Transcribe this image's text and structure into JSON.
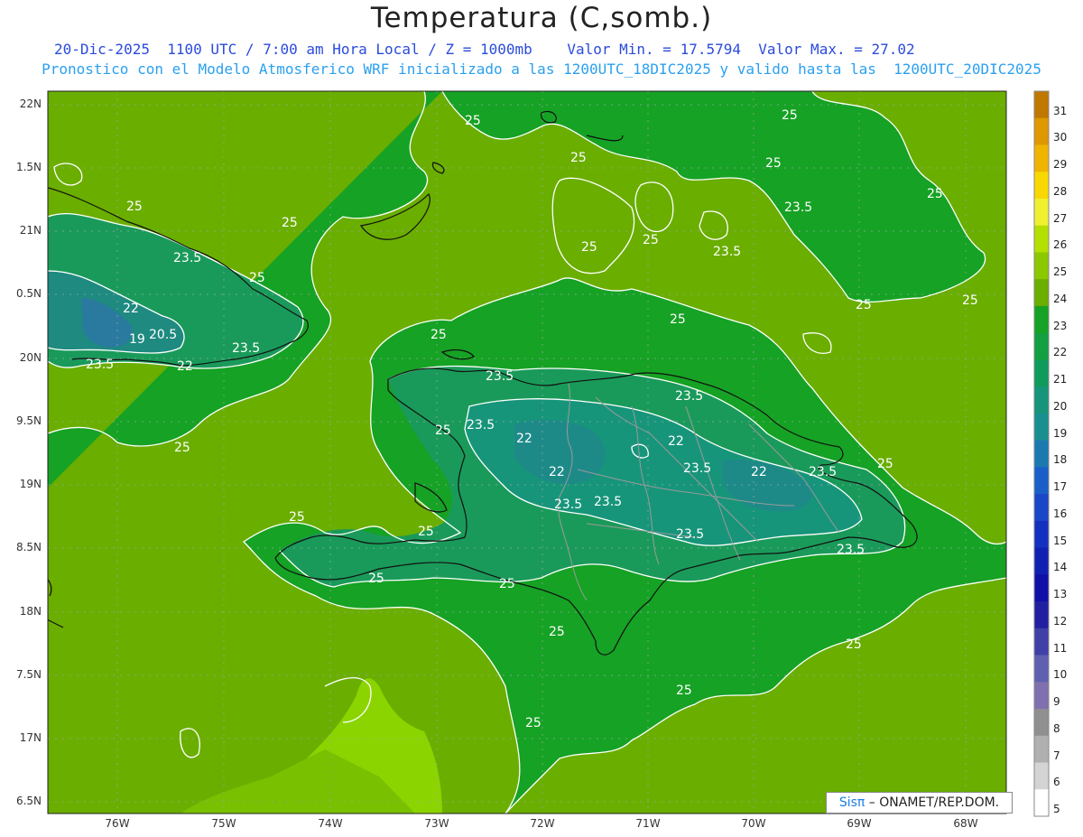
{
  "header": {
    "title": "Temperatura (C,somb.)",
    "line1": "20-Dic-2025  1100 UTC / 7:00 am Hora Local / Z = 1000mb    Valor Min. = 17.5794  Valor Max. = 27.02",
    "line2": "Pronostico con el Modelo Atmosferico WRF inicializado a las 1200UTC_18DIC2025 y valido hasta las  1200UTC_20DIC2025"
  },
  "map": {
    "lat_labels": [
      "22N",
      "1.5N",
      "21N",
      "0.5N",
      "20N",
      "9.5N",
      "19N",
      "8.5N",
      "18N",
      "7.5N",
      "17N",
      "6.5N"
    ],
    "lon_labels": [
      "76W",
      "75W",
      "74W",
      "73W",
      "72W",
      "71W",
      "70W",
      "69W",
      "68W"
    ],
    "contour_labels": [
      "25",
      "23.5",
      "22",
      "20.5",
      "19"
    ],
    "colors": {
      "t24": "#16a224",
      "t25": "#6aae00",
      "t26": "#8cd400",
      "t22": "#1a9a5a",
      "t20": "#1e8a80",
      "t19": "#2a7aa0"
    }
  },
  "colorbar": {
    "labels": [
      "31",
      "30",
      "29",
      "28",
      "27",
      "26",
      "25",
      "24",
      "23",
      "22",
      "21",
      "20",
      "19",
      "18",
      "17",
      "16",
      "15",
      "14",
      "13",
      "12",
      "11",
      "10",
      "9",
      "8",
      "7",
      "6",
      "5"
    ],
    "colors": [
      "#c07800",
      "#e09800",
      "#f0b400",
      "#f8d800",
      "#f0f030",
      "#b4e000",
      "#8cc800",
      "#6aae00",
      "#16a224",
      "#12a040",
      "#109a5c",
      "#16957a",
      "#1a8f90",
      "#1a7ab0",
      "#1a5ec8",
      "#1a46c8",
      "#1430c0",
      "#1020b0",
      "#1010a8",
      "#2020a0",
      "#4040a8",
      "#6060b0",
      "#8070b0",
      "#909090",
      "#b0b0b0",
      "#d4d4d4",
      "#ffffff"
    ]
  },
  "credit": {
    "brand": "Sisπ",
    "text": " – ONAMET/REP.DOM."
  }
}
